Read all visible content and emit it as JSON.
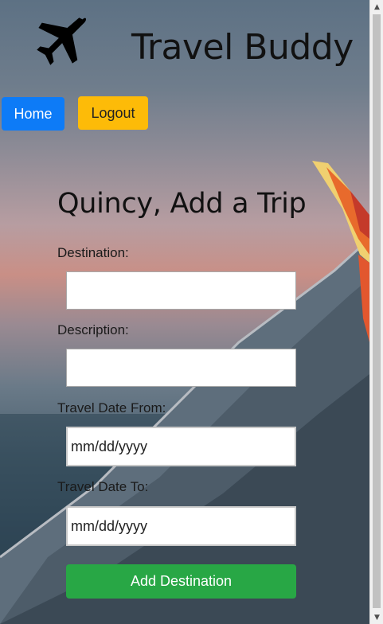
{
  "app": {
    "title": "Travel Buddy",
    "logo_icon": "airplane-icon"
  },
  "nav": {
    "home_label": "Home",
    "logout_label": "Logout"
  },
  "form": {
    "heading": "Quincy, Add a Trip",
    "destination_label": "Destination:",
    "destination_value": "",
    "description_label": "Description:",
    "description_value": "",
    "date_from_label": "Travel Date From:",
    "date_from_placeholder": "mm/dd/yyyy",
    "date_to_label": "Travel Date To:",
    "date_to_placeholder": "mm/dd/yyyy",
    "submit_label": "Add Destination"
  },
  "colors": {
    "home_button": "#0d7bf7",
    "logout_button": "#fdbb08",
    "submit_button": "#28a745"
  }
}
